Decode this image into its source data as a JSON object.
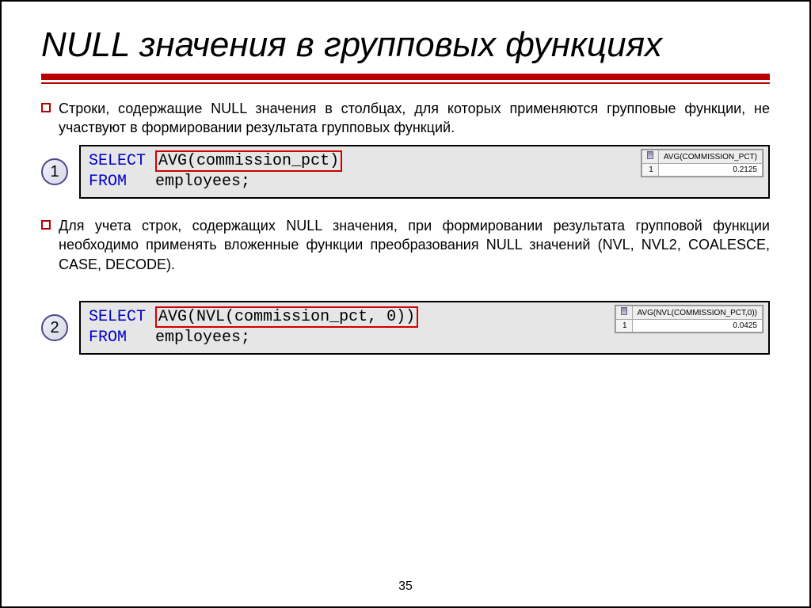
{
  "title": "NULL значения в групповых функциях",
  "bullets": {
    "b1": "Строки, содержащие NULL значения в столбцах, для которых применяются групповые функции, не участвуют в формировании результата групповых функций.",
    "b2": "Для учета строк, содержащих NULL значения, при формировании результата групповой функции необходимо применять вложенные функции преобразования NULL значений (NVL, NVL2, COALESCE, CASE, DECODE)."
  },
  "examples": {
    "e1": {
      "num": "1",
      "kw_select": "SELECT",
      "highlight": "AVG(commission_pct)",
      "kw_from": "FROM",
      "table": "employees;",
      "result_header": "AVG(COMMISSION_PCT)",
      "result_row_idx": "1",
      "result_value": "0.2125"
    },
    "e2": {
      "num": "2",
      "kw_select": "SELECT",
      "highlight": "AVG(NVL(commission_pct, 0))",
      "kw_from": "FROM",
      "table": "employees;",
      "result_header": "AVG(NVL(COMMISSION_PCT,0))",
      "result_row_idx": "1",
      "result_value": "0.0425"
    }
  },
  "page_number": "35"
}
